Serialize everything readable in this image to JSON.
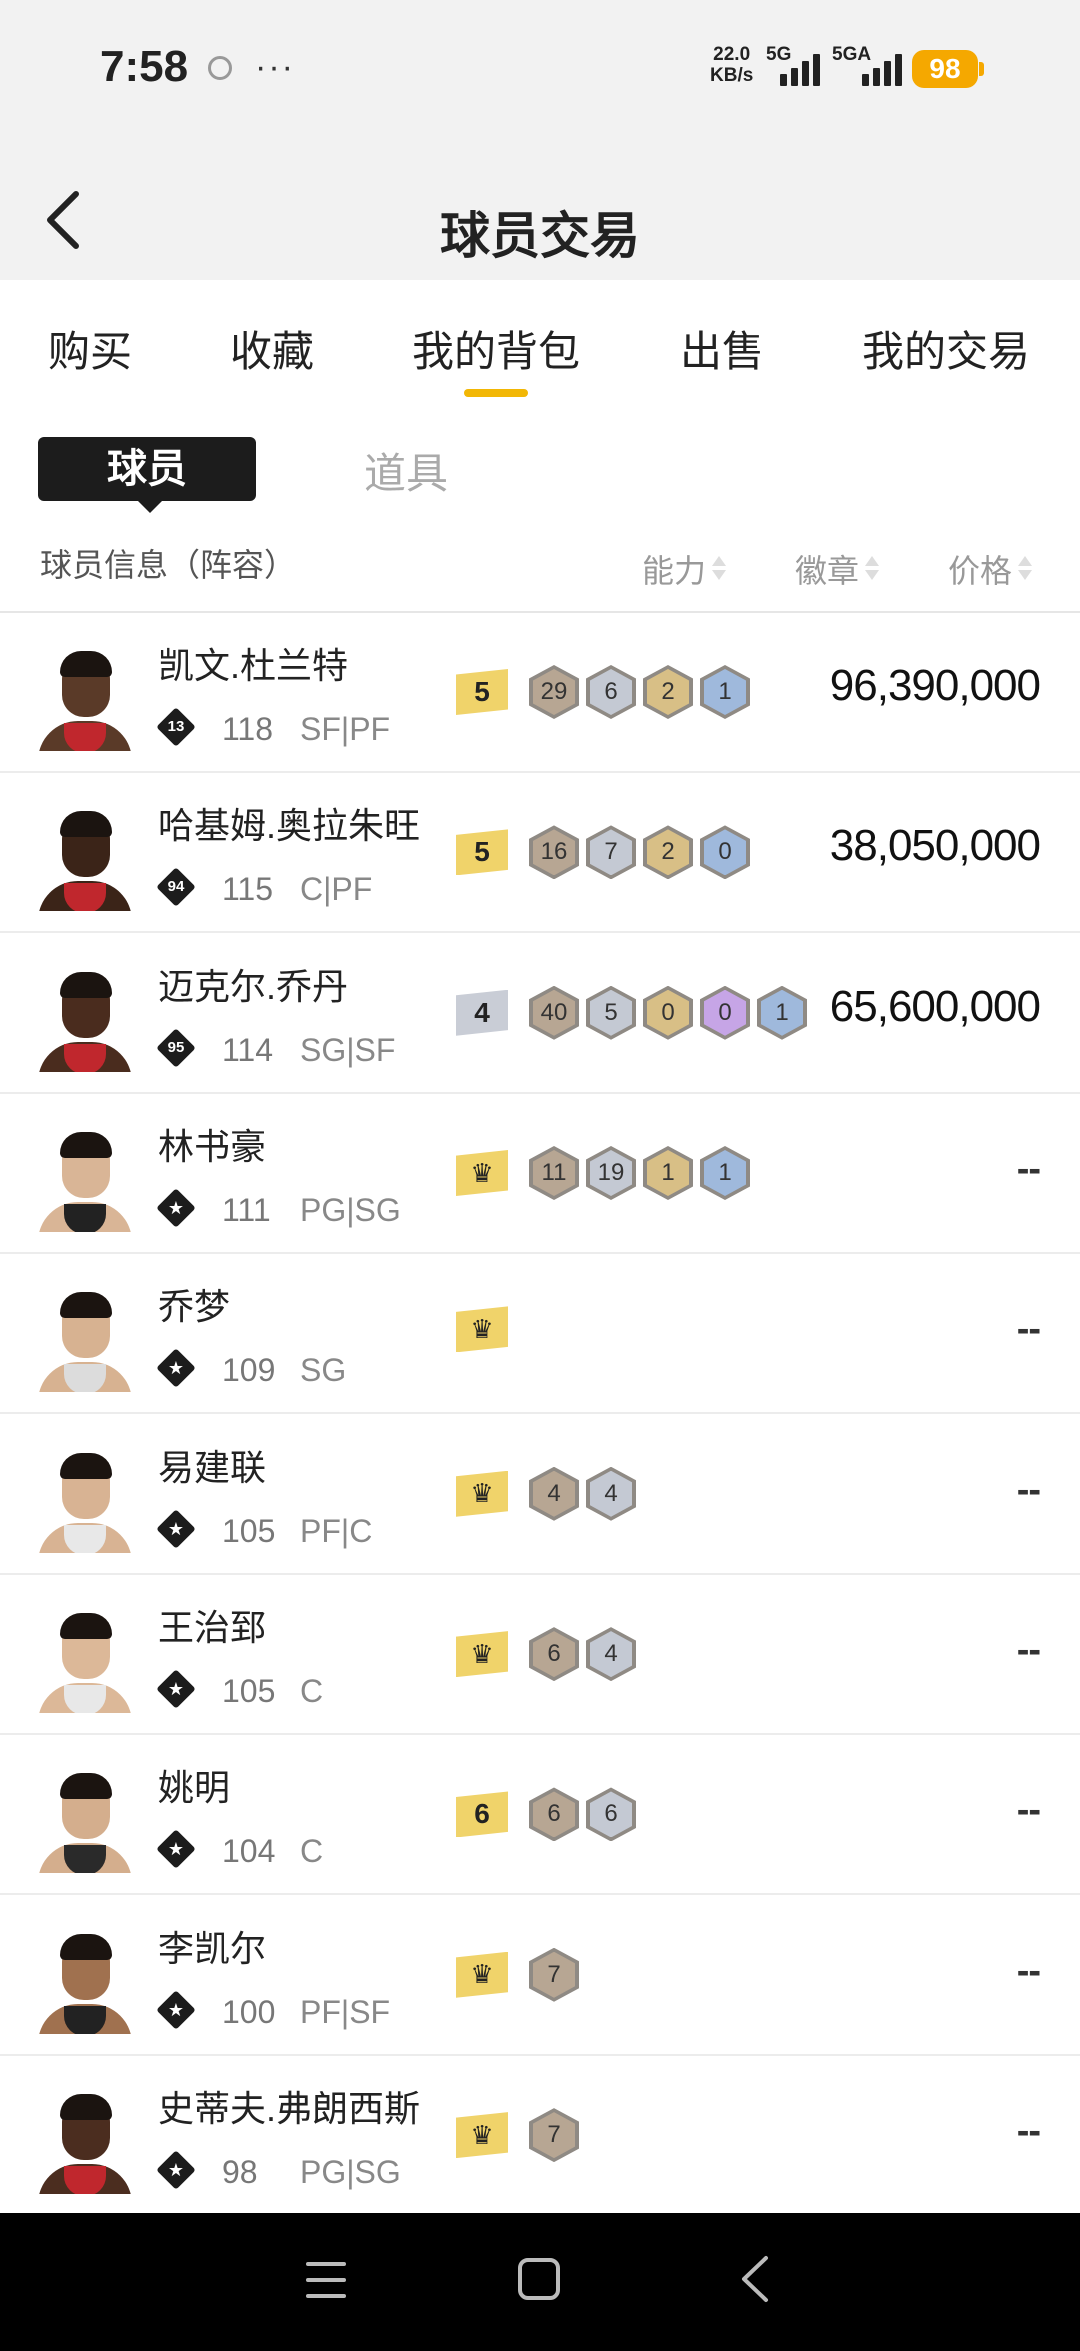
{
  "status_bar": {
    "time": "7:58",
    "dots": "···",
    "speed_value": "22.0",
    "speed_unit": "KB/s",
    "net1": "5G",
    "net2": "5GA",
    "battery": "98"
  },
  "header": {
    "title": "球员交易"
  },
  "tabs": [
    {
      "label": "购买"
    },
    {
      "label": "收藏"
    },
    {
      "label": "我的背包"
    },
    {
      "label": "出售"
    },
    {
      "label": "我的交易"
    }
  ],
  "active_tab": "我的背包",
  "subtabs": {
    "active": "球员",
    "inactive": "道具"
  },
  "columns": {
    "info": "球员信息（阵容）",
    "ability": "能力",
    "badges": "徽章",
    "price": "价格"
  },
  "colors": {
    "accent": "#f2b705",
    "level_gold": "#f0d36a",
    "level_silver": "#c9cdd6",
    "hex_bronze": "#b7a693",
    "hex_silver": "#c4c9d3",
    "hex_gold": "#d8bf86",
    "hex_purple": "#c6a5e6",
    "hex_blue": "#9fb9dc"
  },
  "players": [
    {
      "name": "凯文.杜兰特",
      "badge_num": "13",
      "rating": "118",
      "position": "SF|PF",
      "level": "5",
      "level_type": "gold",
      "chips": [
        {
          "v": "29",
          "c": "bronze"
        },
        {
          "v": "6",
          "c": "silver"
        },
        {
          "v": "2",
          "c": "gold"
        },
        {
          "v": "1",
          "c": "blue"
        }
      ],
      "price": "96,390,000",
      "skin": "#5a3a28",
      "jersey": "#c0272d"
    },
    {
      "name": "哈基姆.奥拉朱旺",
      "badge_num": "94",
      "rating": "115",
      "position": "C|PF",
      "level": "5",
      "level_type": "gold",
      "chips": [
        {
          "v": "16",
          "c": "bronze"
        },
        {
          "v": "7",
          "c": "silver"
        },
        {
          "v": "2",
          "c": "gold"
        },
        {
          "v": "0",
          "c": "blue"
        }
      ],
      "price": "38,050,000",
      "skin": "#3b2418",
      "jersey": "#c0272d"
    },
    {
      "name": "迈克尔.乔丹",
      "badge_num": "95",
      "rating": "114",
      "position": "SG|SF",
      "level": "4",
      "level_type": "silver",
      "chips": [
        {
          "v": "40",
          "c": "bronze"
        },
        {
          "v": "5",
          "c": "silver"
        },
        {
          "v": "0",
          "c": "gold"
        },
        {
          "v": "0",
          "c": "purple"
        },
        {
          "v": "1",
          "c": "blue"
        }
      ],
      "price": "65,600,000",
      "skin": "#4a2c1e",
      "jersey": "#c0272d"
    },
    {
      "name": "林书豪",
      "badge_num": "",
      "rating": "111",
      "position": "PG|SG",
      "level": "crown",
      "level_type": "gold",
      "chips": [
        {
          "v": "11",
          "c": "bronze"
        },
        {
          "v": "19",
          "c": "silver"
        },
        {
          "v": "1",
          "c": "gold"
        },
        {
          "v": "1",
          "c": "blue"
        }
      ],
      "price": "--",
      "skin": "#d9b596",
      "jersey": "#222222"
    },
    {
      "name": "乔梦",
      "badge_num": "",
      "rating": "109",
      "position": "SG",
      "level": "crown",
      "level_type": "gold",
      "chips": [],
      "price": "--",
      "skin": "#d7b291",
      "jersey": "#dcdcdc"
    },
    {
      "name": "易建联",
      "badge_num": "",
      "rating": "105",
      "position": "PF|C",
      "level": "crown",
      "level_type": "gold",
      "chips": [
        {
          "v": "4",
          "c": "bronze"
        },
        {
          "v": "4",
          "c": "silver"
        }
      ],
      "price": "--",
      "skin": "#d8b393",
      "jersey": "#e8e8e8"
    },
    {
      "name": "王治郅",
      "badge_num": "",
      "rating": "105",
      "position": "C",
      "level": "crown",
      "level_type": "gold",
      "chips": [
        {
          "v": "6",
          "c": "bronze"
        },
        {
          "v": "4",
          "c": "silver"
        }
      ],
      "price": "--",
      "skin": "#dcb898",
      "jersey": "#e8e8e8"
    },
    {
      "name": "姚明",
      "badge_num": "",
      "rating": "104",
      "position": "C",
      "level": "6",
      "level_type": "gold",
      "chips": [
        {
          "v": "6",
          "c": "bronze"
        },
        {
          "v": "6",
          "c": "silver"
        }
      ],
      "price": "--",
      "skin": "#d4ae8d",
      "jersey": "#2a2a2a"
    },
    {
      "name": "李凯尔",
      "badge_num": "",
      "rating": "100",
      "position": "PF|SF",
      "level": "crown",
      "level_type": "gold",
      "chips": [
        {
          "v": "7",
          "c": "bronze"
        }
      ],
      "price": "--",
      "skin": "#a0714f",
      "jersey": "#222222"
    },
    {
      "name": "史蒂夫.弗朗西斯",
      "badge_num": "",
      "rating": "98",
      "position": "PG|SG",
      "level": "crown",
      "level_type": "gold",
      "chips": [
        {
          "v": "7",
          "c": "bronze"
        }
      ],
      "price": "--",
      "skin": "#4b2d1f",
      "jersey": "#c0272d"
    }
  ]
}
